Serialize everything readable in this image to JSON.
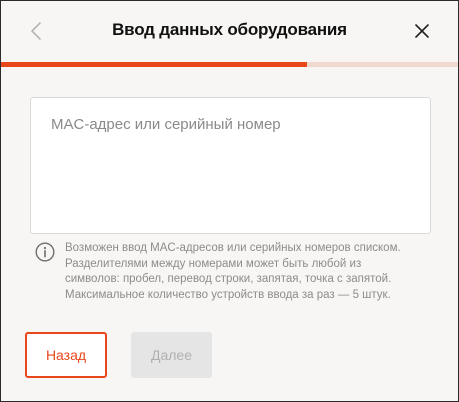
{
  "header": {
    "title": "Ввод данных оборудования",
    "back_icon": "chevron-left-icon",
    "close_icon": "close-icon"
  },
  "progress": {
    "percent": 67,
    "fill_color": "#e8471c",
    "track_color": "#f2d9cf"
  },
  "input": {
    "value": "",
    "placeholder": "MAC-адрес или серийный номер"
  },
  "hint": {
    "icon": "info-icon",
    "lines": [
      "Возможен ввод MAC-адресов или серийных номеров списком.",
      "Разделителями между номерами может быть любой из",
      "символов: пробел, перевод строки, запятая, точка с запятой.",
      "Максимальное количество устройств ввода за раз — 5 штук."
    ]
  },
  "buttons": {
    "back_label": "Назад",
    "next_label": "Далее"
  },
  "colors": {
    "accent": "#e8471c",
    "background": "#f7f6f4",
    "disabled_bg": "#e5e5e5",
    "disabled_text": "#b0b0b0"
  }
}
